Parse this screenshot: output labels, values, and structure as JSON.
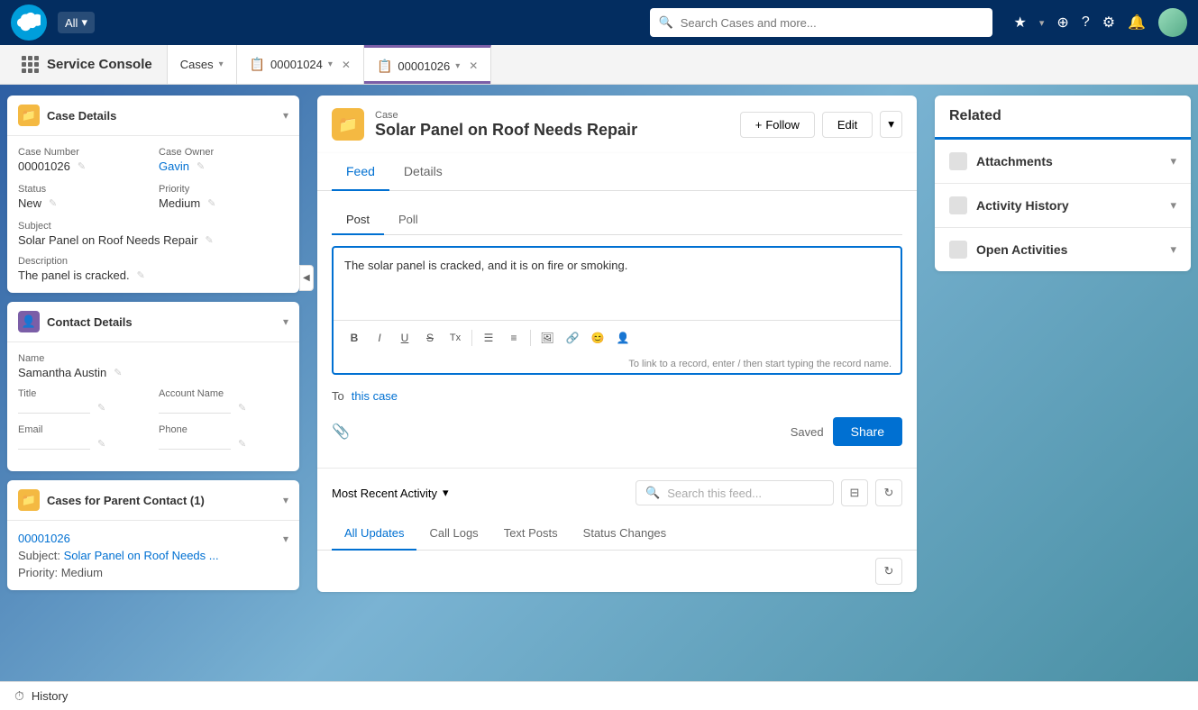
{
  "topNav": {
    "logoAlt": "Salesforce",
    "searchPlaceholder": "Search Cases and more...",
    "allDropdown": "All",
    "navIcons": [
      "star",
      "plus",
      "question",
      "gear",
      "bell",
      "avatar"
    ]
  },
  "tabBar": {
    "appName": "Service Console",
    "tabs": [
      {
        "label": "Cases",
        "id": "cases",
        "hasDropdown": true,
        "active": false
      },
      {
        "label": "00001024",
        "id": "tab-00001024",
        "icon": "📋",
        "hasClose": true,
        "active": false
      },
      {
        "label": "00001026",
        "id": "tab-00001026",
        "icon": "📋",
        "hasClose": true,
        "active": true
      }
    ]
  },
  "leftPanel": {
    "caseDetails": {
      "title": "Case Details",
      "fields": {
        "caseNumber": {
          "label": "Case Number",
          "value": "00001026"
        },
        "caseOwner": {
          "label": "Case Owner",
          "value": "Gavin"
        },
        "status": {
          "label": "Status",
          "value": "New"
        },
        "priority": {
          "label": "Priority",
          "value": "Medium"
        },
        "subject": {
          "label": "Subject",
          "value": "Solar Panel on Roof Needs Repair"
        },
        "description": {
          "label": "Description",
          "value": "The panel is cracked."
        }
      }
    },
    "contactDetails": {
      "title": "Contact Details",
      "fields": {
        "name": {
          "label": "Name",
          "value": "Samantha Austin"
        },
        "title": {
          "label": "Title",
          "value": ""
        },
        "accountName": {
          "label": "Account Name",
          "value": ""
        },
        "email": {
          "label": "Email",
          "value": ""
        },
        "phone": {
          "label": "Phone",
          "value": ""
        }
      }
    },
    "casesParentContact": {
      "title": "Cases for Parent Contact (1)",
      "caseLink": "00001026",
      "subject": {
        "label": "Subject:",
        "value": "Solar Panel on Roof Needs ..."
      },
      "priority": {
        "label": "Priority:",
        "value": "Medium"
      }
    }
  },
  "caseHeader": {
    "label": "Case",
    "title": "Solar Panel on Roof Needs Repair",
    "followBtn": "Follow",
    "editBtn": "Edit"
  },
  "feedSection": {
    "tabs": [
      "Feed",
      "Details"
    ],
    "activeTab": "Feed",
    "feedTabs": [
      "Post",
      "Poll"
    ],
    "activeFeedTab": "Post",
    "editorText": "The solar panel is cracked, and it is on fire or smoking.",
    "editorHint": "To link to a record, enter / then start typing the record name.",
    "toLabel": "To",
    "toValue": "this case",
    "savedLabel": "Saved",
    "shareBtn": "Share",
    "activityDropdown": "Most Recent Activity",
    "searchFeedPlaceholder": "Search this feed...",
    "filterTabs": [
      "All Updates",
      "Call Logs",
      "Text Posts",
      "Status Changes"
    ],
    "activeFilterTab": "All Updates"
  },
  "rightPanel": {
    "relatedTitle": "Related",
    "sections": [
      {
        "title": "Attachments"
      },
      {
        "title": "Activity History"
      },
      {
        "title": "Open Activities"
      }
    ]
  },
  "bottomBar": {
    "historyLabel": "History"
  }
}
